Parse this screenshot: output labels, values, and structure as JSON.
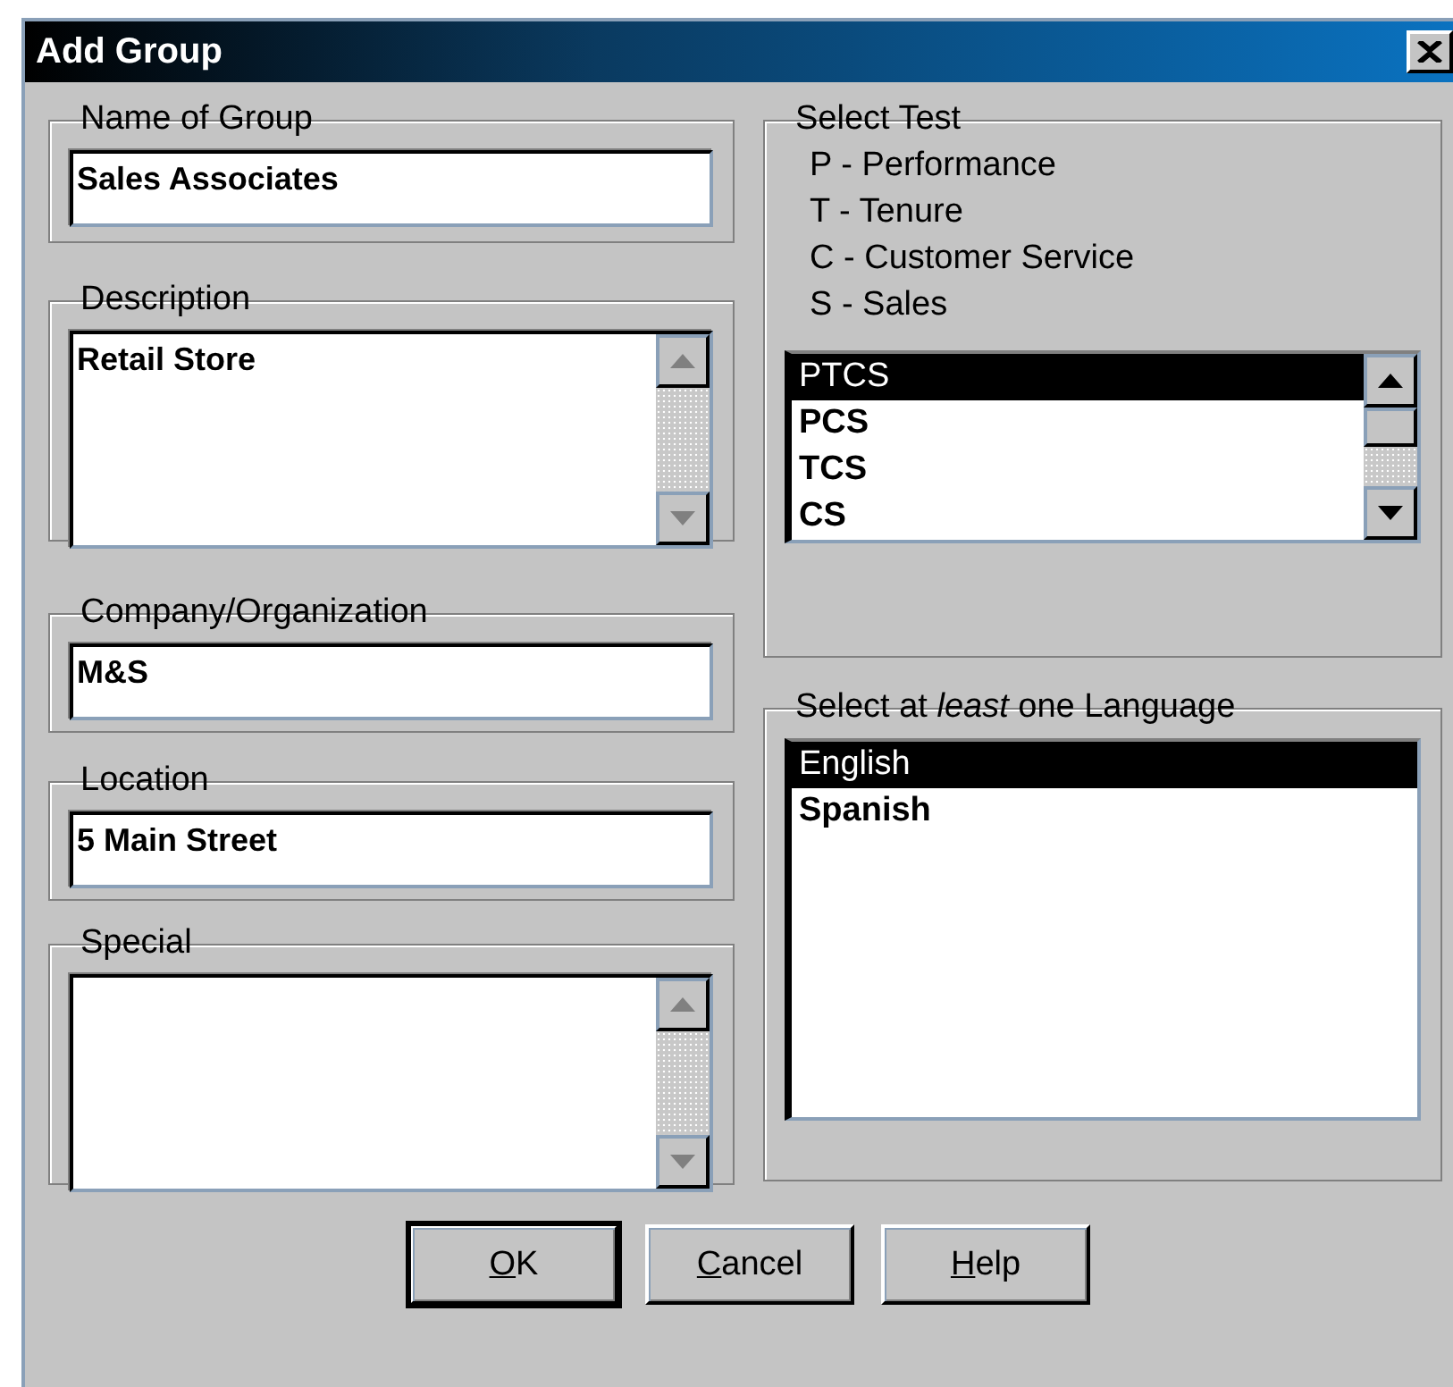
{
  "window": {
    "title": "Add Group"
  },
  "fields": [
    {
      "kind": "line",
      "label": "Name of Group",
      "value": "Sales Associates"
    },
    {
      "kind": "memo",
      "label": "Description",
      "value": "Retail Store",
      "scroll_enabled": false
    },
    {
      "kind": "line",
      "label": "Company/Organization",
      "value": "M&S"
    },
    {
      "kind": "line",
      "label": "Location",
      "value": "5 Main Street"
    },
    {
      "kind": "memo",
      "label": "Special",
      "scroll_enabled": false
    }
  ],
  "select_test": {
    "label": "Select Test",
    "key_lines": [
      "P - Performance",
      "T - Tenure",
      "C - Customer Service",
      "S - Sales"
    ],
    "scroll_enabled": true,
    "options": [
      {
        "label": "PTCS",
        "selected": true
      },
      {
        "label": "PCS",
        "selected": false
      },
      {
        "label": "TCS",
        "selected": false
      },
      {
        "label": "CS",
        "selected": false
      }
    ]
  },
  "languages": {
    "label": "Select at *least* one Language",
    "options": [
      {
        "label": "English",
        "selected": true
      },
      {
        "label": "Spanish",
        "selected": false
      }
    ]
  },
  "buttons": [
    {
      "label": "OK",
      "mnemonic": true,
      "default": true
    },
    {
      "label": "Cancel",
      "mnemonic": true,
      "default": false
    },
    {
      "label": "Help",
      "mnemonic": true,
      "default": false
    }
  ]
}
